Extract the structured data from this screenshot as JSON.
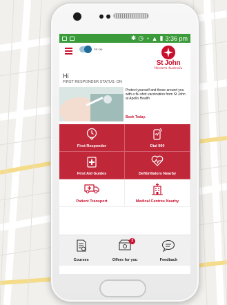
{
  "status_bar": {
    "time": "3:36 pm"
  },
  "header": {
    "fr_toggle_label": "FR ON",
    "brand_name": "St John",
    "brand_sub": "Western Australia"
  },
  "greeting": {
    "hi": "Hi",
    "status": "FIRST RESPONDER STATUS: ON"
  },
  "promo": {
    "text": "Protect yourself and those around you with a flu shot vaccination from St John at Apollo Health",
    "link": "Book Today."
  },
  "tiles": [
    {
      "label": "First Responder",
      "icon": "location-pin-icon"
    },
    {
      "label": "Dial 000",
      "icon": "phone-call-icon"
    },
    {
      "label": "First Aid Guides",
      "icon": "first-aid-kit-icon"
    },
    {
      "label": "Defibrillators Nearby",
      "icon": "heart-pulse-icon"
    },
    {
      "label": "Patient Transport",
      "icon": "ambulance-icon"
    },
    {
      "label": "Medical Centres Nearby",
      "icon": "hospital-building-icon"
    }
  ],
  "bottom_nav": [
    {
      "label": "Courses",
      "icon": "courses-icon"
    },
    {
      "label": "Offers for you",
      "icon": "offers-icon",
      "badge": "2"
    },
    {
      "label": "Feedback",
      "icon": "feedback-icon"
    }
  ],
  "colors": {
    "brand_red": "#c8102e",
    "tile_red": "#c0283a",
    "status_green": "#3b9b3a"
  }
}
